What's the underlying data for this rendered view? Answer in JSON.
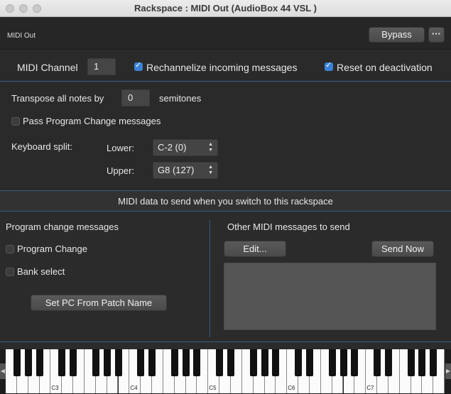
{
  "window": {
    "title": "Rackspace : MIDI Out (AudioBox 44 VSL )"
  },
  "header": {
    "plugin_name": "MIDI Out",
    "bypass_label": "Bypass",
    "more_label": "···"
  },
  "midi_channel": {
    "label": "MIDI Channel",
    "value": "1"
  },
  "rechannelize": {
    "label": "Rechannelize incoming messages",
    "checked": true
  },
  "reset_deactivation": {
    "label": "Reset on deactivation",
    "checked": true
  },
  "transpose": {
    "label": "Transpose all notes by",
    "value": "0",
    "unit": "semitones"
  },
  "pass_program_change": {
    "label": "Pass Program Change messages",
    "checked": false
  },
  "keyboard_split": {
    "label": "Keyboard split:",
    "lower_label": "Lower:",
    "lower_value": "C-2 (0)",
    "upper_label": "Upper:",
    "upper_value": "G8 (127)"
  },
  "send_section": {
    "title": "MIDI data to send when you switch to this rackspace"
  },
  "program_change": {
    "title": "Program change messages",
    "program_change_label": "Program Change",
    "bank_select_label": "Bank select",
    "set_pc_button": "Set PC From Patch Name"
  },
  "other_midi": {
    "title": "Other MIDI messages to send",
    "edit_button": "Edit...",
    "send_now_button": "Send Now"
  },
  "piano": {
    "octave_labels": [
      "C3",
      "C4",
      "C5",
      "C6",
      "C7"
    ]
  },
  "colors": {
    "accent": "#3b82d6",
    "divider": "#2e5f86",
    "background": "#2a2a2a"
  }
}
